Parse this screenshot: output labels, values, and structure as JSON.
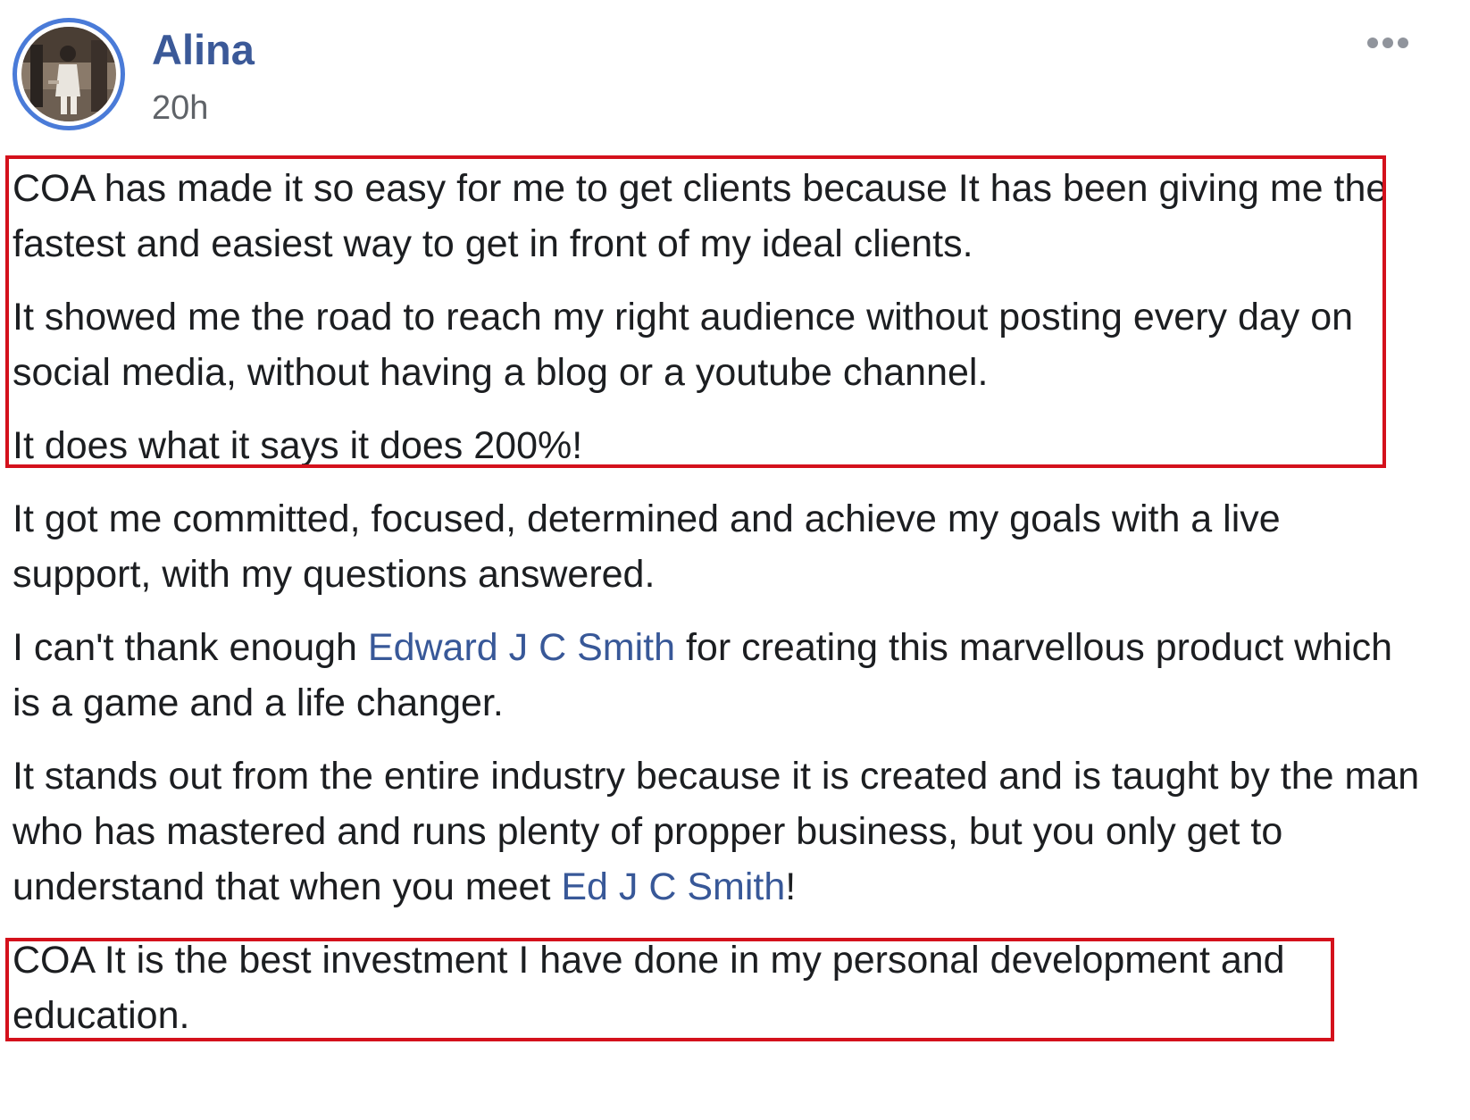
{
  "post": {
    "author": {
      "name": "Alina",
      "avatar_icon": "profile-photo",
      "avatar_ring_color": "#4a7bd8"
    },
    "timestamp": "20h",
    "more_options_icon": "ellipsis-icon",
    "paragraphs": [
      {
        "segments": [
          {
            "text": "COA has made it so easy for me to get clients because It has been giving me the fastest and easiest way to get in front of my ideal clients."
          }
        ]
      },
      {
        "segments": [
          {
            "text": "It showed me the road to reach my right audience without posting every day on social media, without having a blog or a youtube channel."
          }
        ]
      },
      {
        "segments": [
          {
            "text": "It does what it says it does 200%!"
          }
        ]
      },
      {
        "segments": [
          {
            "text": "It got me committed, focused, determined and achieve my goals with a live support, with my questions answered."
          }
        ]
      },
      {
        "segments": [
          {
            "text": "I can't thank enough "
          },
          {
            "text": "Edward J C Smith",
            "mention": true
          },
          {
            "text": " for creating this marvellous product which is a game and a life changer."
          }
        ]
      },
      {
        "segments": [
          {
            "text": "It stands out from the entire industry because it is created and is taught by the man who has mastered and runs plenty of propper business, but you only get to understand that when you meet "
          },
          {
            "text": "Ed J C Smith",
            "mention": true
          },
          {
            "text": "!"
          }
        ]
      },
      {
        "segments": [
          {
            "text": "COA It is the best investment I have done in my personal development and education."
          }
        ]
      }
    ]
  },
  "colors": {
    "author_link": "#3b5998",
    "mention_link": "#385898",
    "body_text": "#1c1e21",
    "timestamp": "#5f6368",
    "highlight_border": "#d4111c"
  }
}
